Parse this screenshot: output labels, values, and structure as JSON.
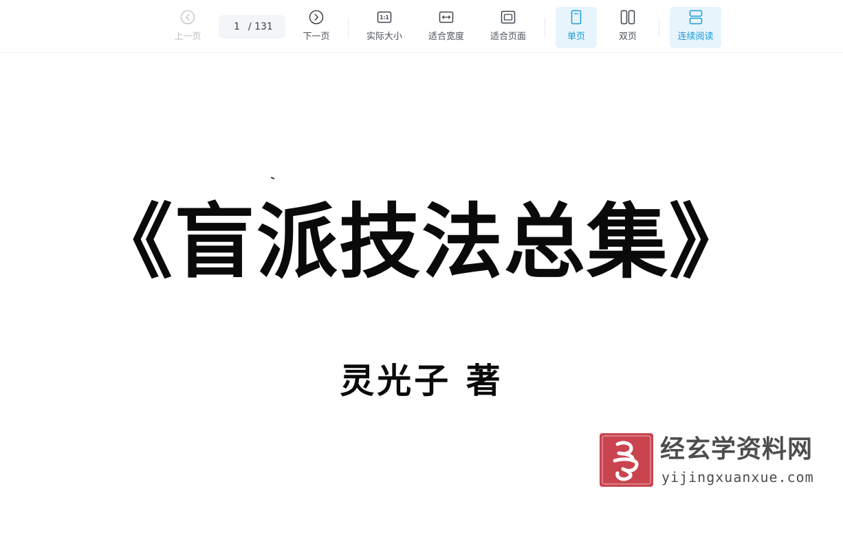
{
  "toolbar": {
    "prev_label": "上一页",
    "current_page": "1",
    "total_pages": "/ 131",
    "next_label": "下一页",
    "actual_size_label": "实际大小",
    "actual_size_icon_text": "1:1",
    "fit_width_label": "适合宽度",
    "fit_page_label": "适合页面",
    "single_page_label": "单页",
    "double_page_label": "双页",
    "continuous_label": "连续阅读",
    "active_color": "#1a9ad6",
    "active_bg": "#e8f4fc"
  },
  "document": {
    "title": "《盲派技法总集》",
    "author": "灵光子  著"
  },
  "watermark": {
    "site_name": "经玄学资料网",
    "url": "yijingxuanxue.com",
    "logo_color": "#c9444f"
  }
}
